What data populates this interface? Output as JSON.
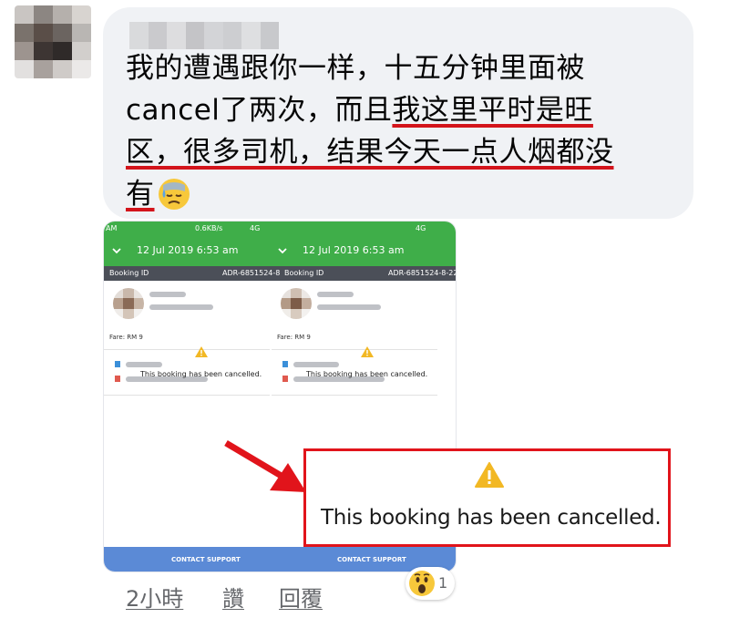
{
  "comment": {
    "author_name": "",
    "text_plain_1": "我的遭遇跟你一样，十五分钟里面被",
    "text_plain_2": "cancel了两次，而且",
    "text_highlight_1": "我这里平时是旺",
    "text_highlight_2": "区，很多司机，结果今天一点人烟都没",
    "text_highlight_3": "有",
    "emoji": "sweat-downcast-face-icon"
  },
  "screenshot": {
    "status_left": "AM",
    "status_speed_1": "0.6KB/s",
    "status_net_1": "4G",
    "status_net_2": "4G",
    "date_left": "12 Jul 2019 6:53 am",
    "date_right": "12 Jul 2019 6:53 am",
    "booking_id_label_1": "Booking ID",
    "booking_id_value_1": "ADR-6851524-8",
    "booking_id_label_2": "Booking ID",
    "booking_id_value_2": "ADR-6851524-8-22",
    "fare_left": "Fare: RM 9",
    "fare_right": "Fare: RM 9",
    "cancel_left": "This booking has been cancelled.",
    "cancel_right": "This booking has been cancelled.",
    "support_left": "CONTACT SUPPORT",
    "support_right": "CONTACT SUPPORT",
    "header_color": "#3fae49",
    "support_color": "#5b8ad6"
  },
  "callout": {
    "text": "This booking has been cancelled.",
    "border_color": "#e1141b",
    "icon": "warning-triangle-icon"
  },
  "footer": {
    "time": "2小時",
    "like": "讚",
    "reply": "回覆",
    "reaction_icon": "wow-emoji-icon",
    "reaction_count": "1"
  }
}
